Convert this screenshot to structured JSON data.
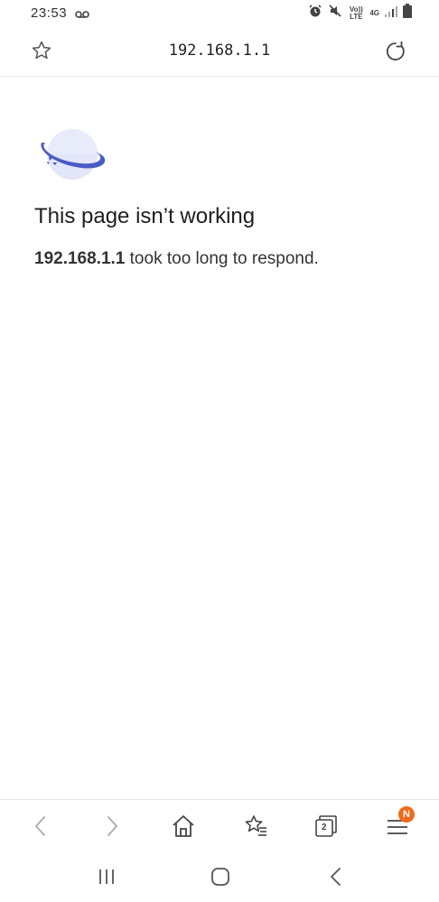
{
  "status_bar": {
    "time": "23:53",
    "volte_label": "Vo)) LTE",
    "network_label": "4G"
  },
  "address_bar": {
    "url": "192.168.1.1"
  },
  "error": {
    "title": "This page isn’t working",
    "host": "192.168.1.1",
    "message": " took too long to respond."
  },
  "toolbar": {
    "tabs_count": "2",
    "menu_badge": "N",
    "badge_color": "#f26a1b"
  },
  "icons": {
    "bookmark": "star-icon",
    "reload": "refresh-icon",
    "error": "planet-icon",
    "back": "chevron-left-icon",
    "forward": "chevron-right-icon",
    "home": "home-icon",
    "bookmarks": "bookmarks-icon",
    "tabs": "tabs-icon",
    "menu": "menu-icon"
  }
}
